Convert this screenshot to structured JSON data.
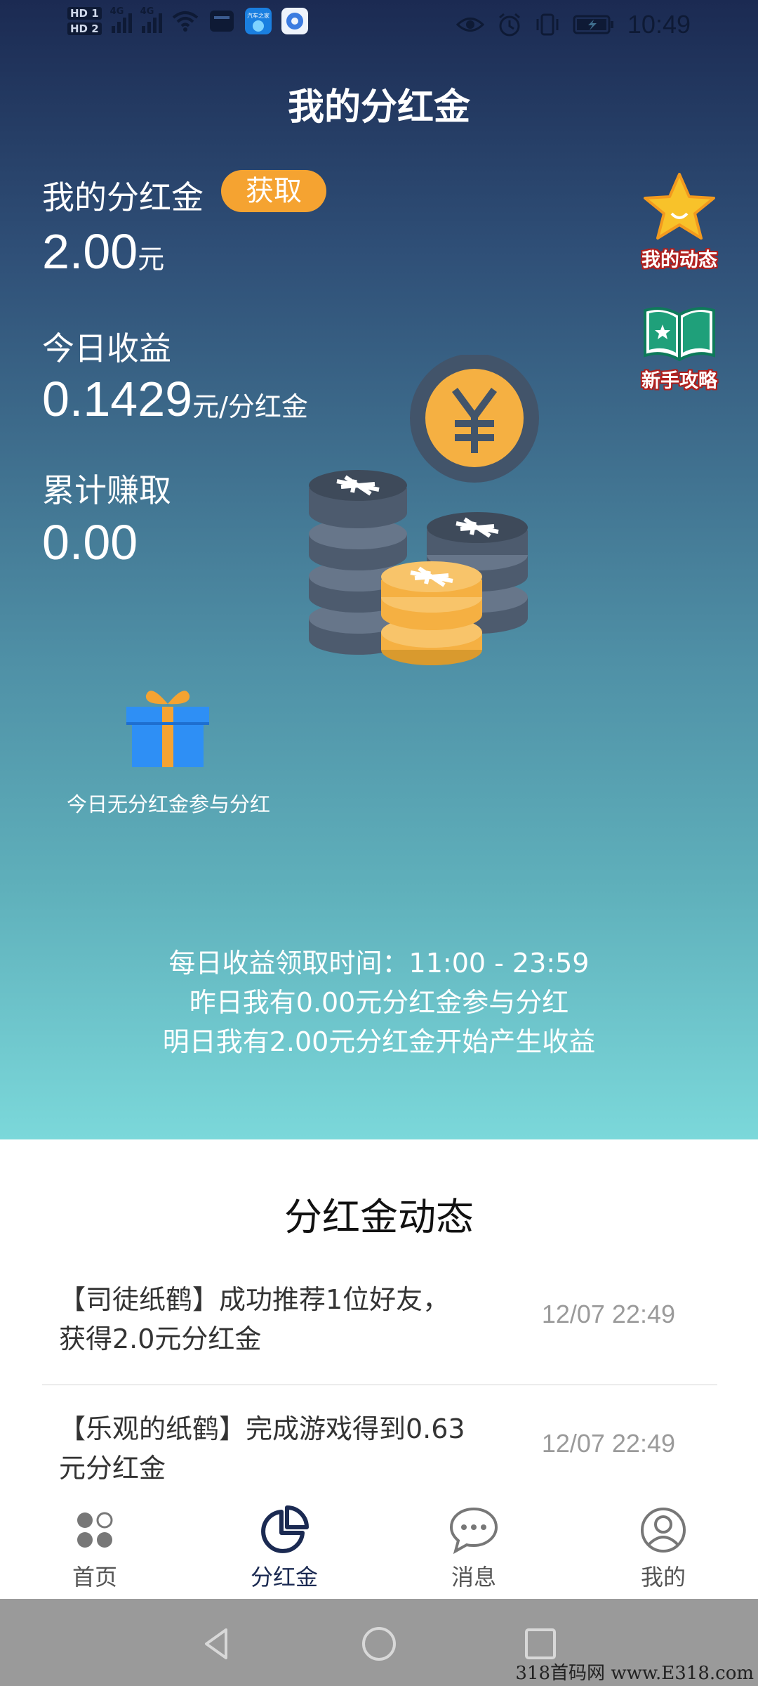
{
  "status_bar": {
    "time": "10:49",
    "hd1": "HD 1",
    "hd2": "HD 2",
    "net1": "4G",
    "net2": "4G",
    "app_icon_1_text": "汽车之家",
    "icons": [
      "signal-icon",
      "signal-icon",
      "wifi-icon",
      "app-icon",
      "app-icon",
      "app-icon",
      "eye-icon",
      "alarm-icon",
      "vibrate-icon",
      "battery-icon"
    ]
  },
  "header": {
    "title": "我的分红金"
  },
  "summary": {
    "dividend_label": "我的分红金",
    "get_button": "获取",
    "dividend_value": "2.00",
    "dividend_unit": "元",
    "today_label": "今日收益",
    "today_value": "0.1429",
    "today_unit": "元/分红金",
    "total_label": "累计赚取",
    "total_value": "0.00"
  },
  "side_actions": [
    {
      "label": "我的动态",
      "icon": "star-icon"
    },
    {
      "label": "新手攻略",
      "icon": "book-icon"
    }
  ],
  "gift": {
    "icon": "gift-icon",
    "text": "今日无分红金参与分红"
  },
  "info_lines": [
    "每日收益领取时间：11:00 - 23:59",
    "昨日我有0.00元分红金参与分红",
    "明日我有2.00元分红金开始产生收益"
  ],
  "feed": {
    "title": "分红金动态",
    "items": [
      {
        "text_line1": "【司徒纸鹤】成功推荐1位好友，",
        "text_line2": "获得2.0元分红金",
        "time": "12/07 22:49"
      },
      {
        "text_line1": "【乐观的纸鹤】完成游戏得到0.63",
        "text_line2": "元分红金",
        "time": "12/07 22:49"
      }
    ]
  },
  "bottom_nav": {
    "active": "分红金",
    "items": [
      {
        "label": "首页",
        "icon": "home-grid-icon"
      },
      {
        "label": "分红金",
        "icon": "pie-chart-icon"
      },
      {
        "label": "消息",
        "icon": "message-icon"
      },
      {
        "label": "我的",
        "icon": "profile-icon"
      }
    ]
  },
  "watermark": "318首码网 www.E318.com",
  "colors": {
    "accent_orange": "#f5a331",
    "hero_top": "#1b2a52",
    "hero_bottom": "#7bd8da",
    "nav_active": "#1b2a52",
    "side_label_outline": "#b0201e"
  }
}
